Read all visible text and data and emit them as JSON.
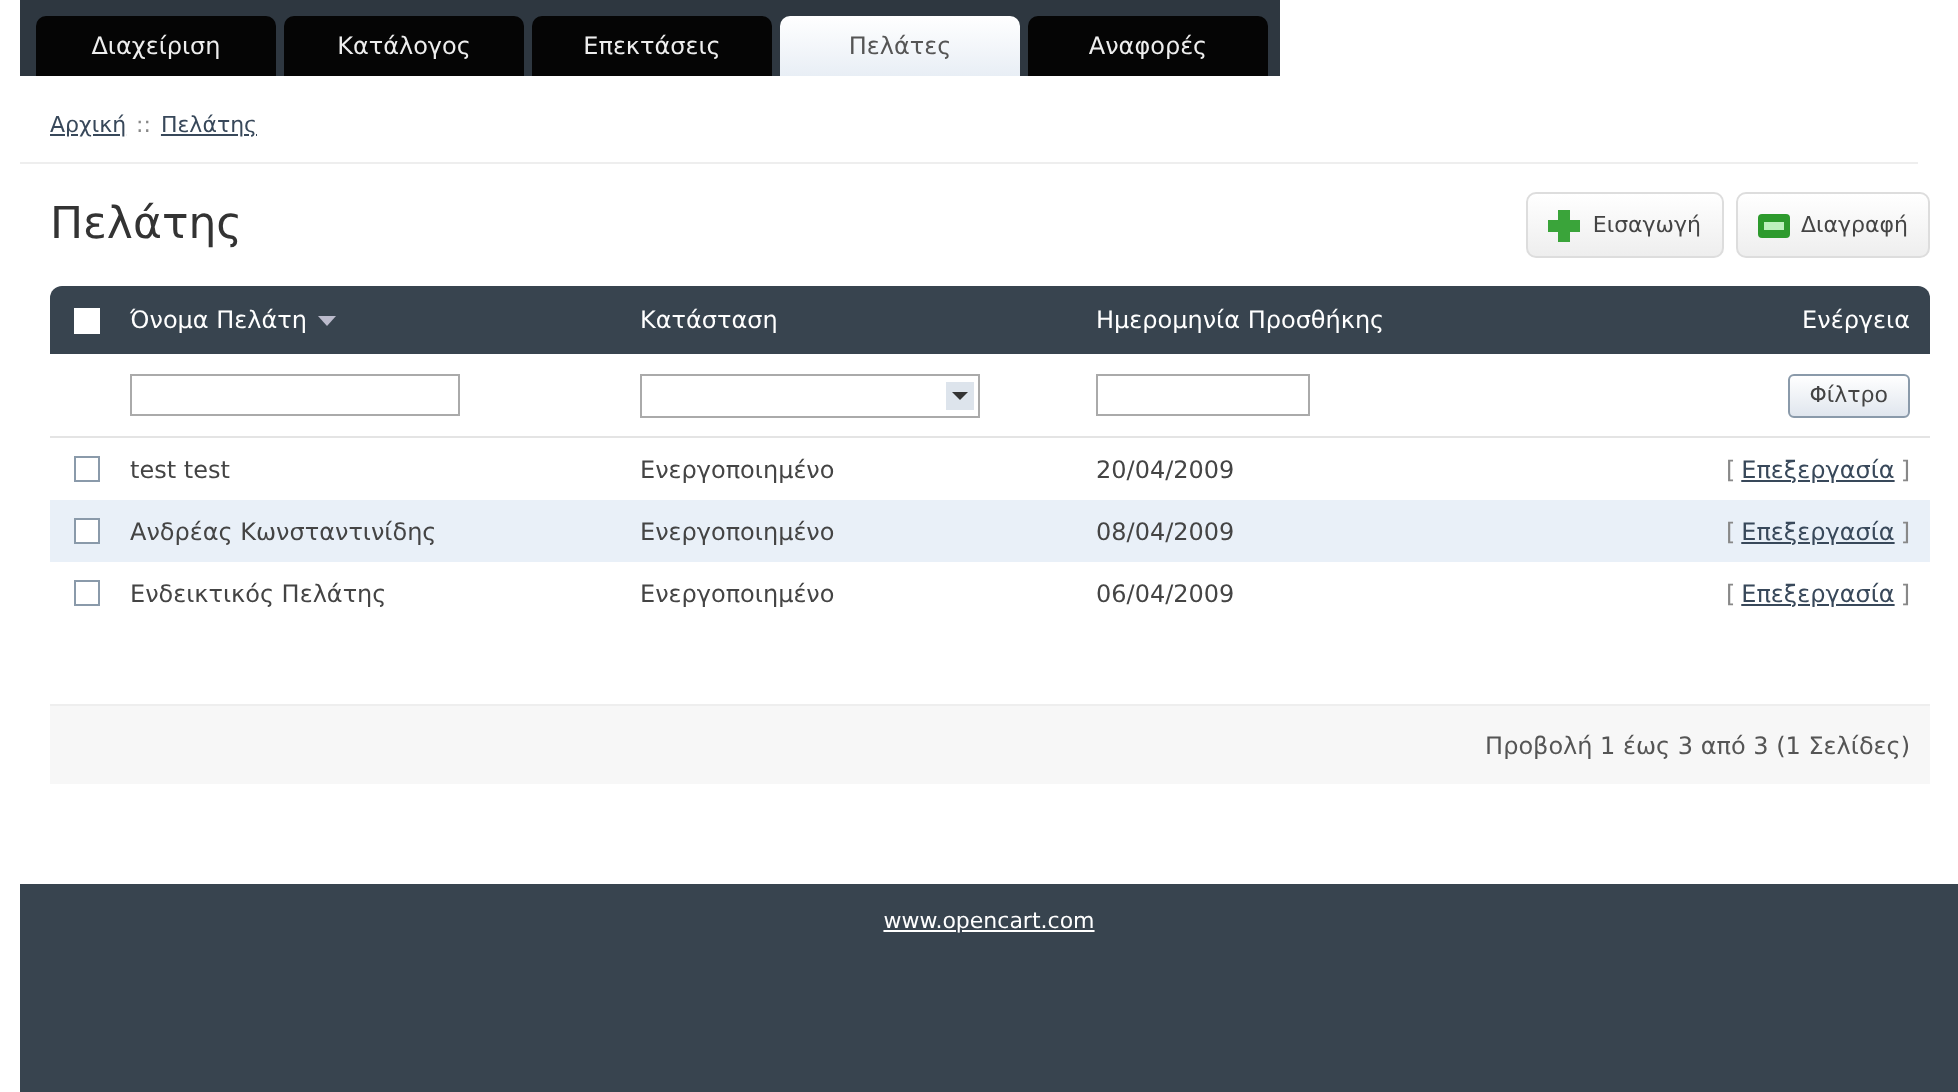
{
  "tabs": [
    {
      "label": "Διαχείριση",
      "selected": false
    },
    {
      "label": "Κατάλογος",
      "selected": false
    },
    {
      "label": "Επεκτάσεις",
      "selected": false
    },
    {
      "label": "Πελάτες",
      "selected": true
    },
    {
      "label": "Αναφορές",
      "selected": false
    }
  ],
  "breadcrumb": {
    "links": [
      "Αρχική",
      "Πελάτης"
    ],
    "separator": "::"
  },
  "heading": "Πελάτης",
  "buttons": [
    {
      "kind": "add",
      "label": "Εισαγωγή"
    },
    {
      "kind": "remove",
      "label": "Διαγραφή"
    }
  ],
  "table": {
    "select_all_checked": false,
    "columns": [
      {
        "label": "Όνομα Πελάτη",
        "sorted": true
      },
      {
        "label": "Κατάσταση",
        "sorted": false
      },
      {
        "label": "Ημερομηνία Προσθήκης",
        "sorted": false
      },
      {
        "label": "Ενέργεια",
        "sorted": false
      }
    ],
    "filter_button": "Φίλτρο",
    "rows": [
      {
        "checked": false,
        "highlighted": false,
        "name": "test test",
        "status": "Ενεργοποιημένο",
        "date": "20/04/2009",
        "open_bracket": "[",
        "action": "Επεξεργασία",
        "close_bracket": "]"
      },
      {
        "checked": false,
        "highlighted": true,
        "name": "Ανδρέας Κωνσταντινίδης",
        "status": "Ενεργοποιημένο",
        "date": "08/04/2009",
        "open_bracket": "[",
        "action": "Επεξεργασία",
        "close_bracket": "]"
      },
      {
        "checked": false,
        "highlighted": false,
        "name": "Ενδεικτικός Πελάτης",
        "status": "Ενεργοποιημένο",
        "date": "06/04/2009",
        "open_bracket": "[",
        "action": "Επεξεργασία",
        "close_bracket": "]"
      }
    ]
  },
  "pagination": "Προβολή 1 έως 3 από 3 (1 Σελίδες)",
  "footer_link": "www.opencart.com"
}
